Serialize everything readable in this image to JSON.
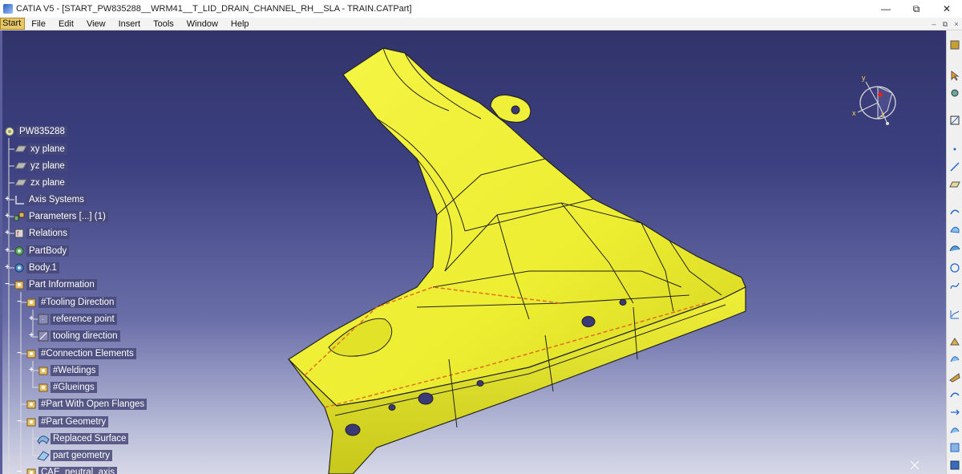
{
  "window": {
    "title": "CATIA V5 - [START_PW835288__WRM41__T_LID_DRAIN_CHANNEL_RH__SLA - TRAIN.CATPart]",
    "minimize_glyph": "—",
    "restore_glyph": "⧉",
    "close_glyph": "✕"
  },
  "menu": {
    "items": [
      {
        "label": "Start"
      },
      {
        "label": "File"
      },
      {
        "label": "Edit"
      },
      {
        "label": "View"
      },
      {
        "label": "Insert"
      },
      {
        "label": "Tools"
      },
      {
        "label": "Window"
      },
      {
        "label": "Help"
      }
    ],
    "right_glyphs": [
      "–",
      "⧉",
      "×"
    ]
  },
  "tree": {
    "root": "PW835288",
    "items": [
      {
        "label": "xy plane",
        "icon": "plane-icon"
      },
      {
        "label": "yz plane",
        "icon": "plane-icon"
      },
      {
        "label": "zx plane",
        "icon": "plane-icon"
      },
      {
        "label": "Axis Systems",
        "icon": "axis-system-icon"
      },
      {
        "label": "Parameters [...] (1)",
        "icon": "parameters-icon"
      },
      {
        "label": "Relations",
        "icon": "relations-icon"
      },
      {
        "label": "PartBody",
        "icon": "gear-body-icon"
      },
      {
        "label": "Body.1",
        "icon": "gear-body-icon"
      },
      {
        "label": "Part Information",
        "icon": "set-icon"
      },
      {
        "label": "#Tooling Direction",
        "icon": "set-icon"
      },
      {
        "label": "reference point",
        "icon": "point-icon"
      },
      {
        "label": "tooling direction",
        "icon": "line-icon"
      },
      {
        "label": "#Connection Elements",
        "icon": "set-icon"
      },
      {
        "label": "#Weldings",
        "icon": "set-icon"
      },
      {
        "label": "#Glueings",
        "icon": "set-icon"
      },
      {
        "label": "#Part With Open Flanges",
        "icon": "set-icon"
      },
      {
        "label": "#Part Geometry",
        "icon": "set-icon"
      },
      {
        "label": "Replaced Surface",
        "icon": "surface-icon"
      },
      {
        "label": "part geometry",
        "icon": "surface-icon"
      },
      {
        "label": "CAE_neutral_axis",
        "icon": "set-icon"
      }
    ]
  },
  "compass": {
    "x_label": "x",
    "y_label": "y",
    "z_label": "z"
  },
  "colors": {
    "part_yellow": "#f2f23a",
    "background_top": "#31346a",
    "background_bottom": "#d7d8e6",
    "tree_label_bg": "#464878"
  },
  "toolbar_right": {
    "icons": [
      "sketch-icon",
      "select-arrow-icon",
      "snap-icon",
      "sketcher-icon",
      "point-icon",
      "line-icon",
      "plane-icon",
      "extrude-icon",
      "revolve-icon",
      "sweep-icon",
      "fill-icon",
      "circle-icon",
      "spline-icon",
      "curve-icon",
      "join-icon",
      "split-icon",
      "trim-icon",
      "offset-icon",
      "translate-icon",
      "extrapolate-icon",
      "analysis-icon",
      "measure-icon"
    ]
  }
}
